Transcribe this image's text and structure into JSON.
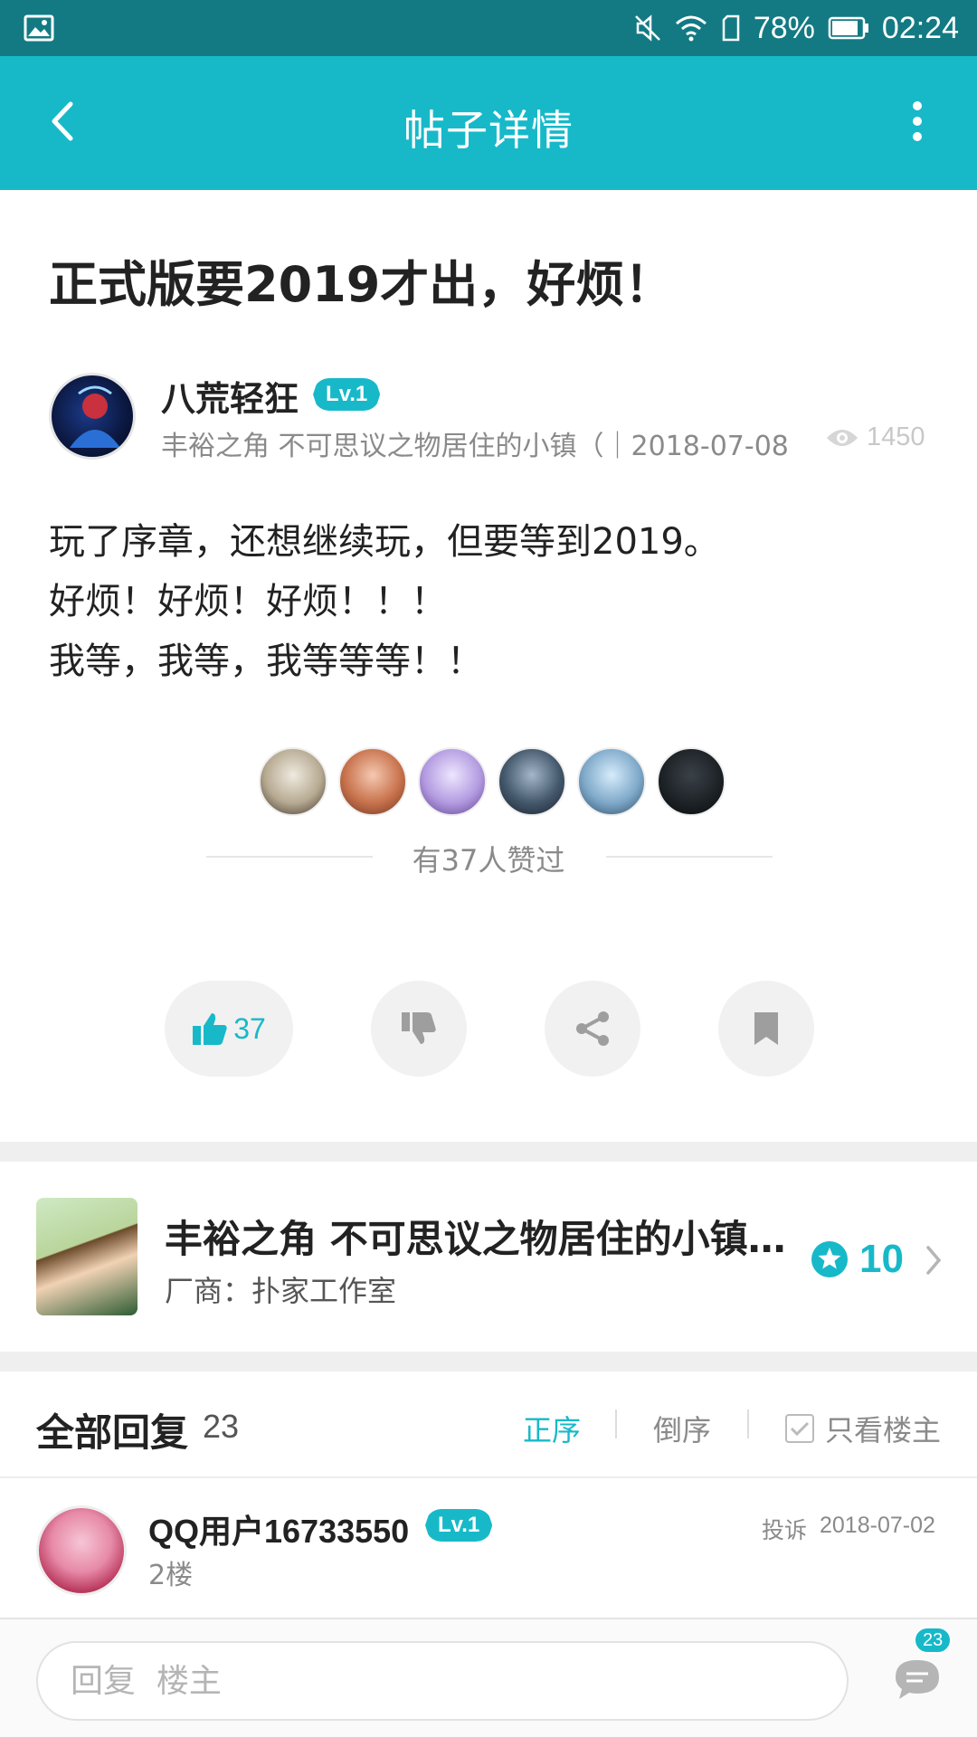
{
  "status_bar": {
    "battery": "78%",
    "time": "02:24"
  },
  "app_bar": {
    "title": "帖子详情"
  },
  "post": {
    "title": "正式版要2019才出，好烦！",
    "author": {
      "name": "八荒轻狂",
      "level": "Lv.1",
      "meta": "丰裕之角 不可思议之物居住的小镇（｜2018-07-08"
    },
    "views": "1450",
    "body_lines": [
      "玩了序章，还想继续玩，但要等到2019。",
      "好烦！好烦！好烦！！！",
      "我等，我等，我等等等！！"
    ],
    "likers": [
      {
        "name": "liker-1",
        "color": "#d9d4c9"
      },
      {
        "name": "liker-2",
        "color": "#c98a6a"
      },
      {
        "name": "liker-3",
        "color": "#b8a6dc"
      },
      {
        "name": "liker-4",
        "color": "#3c4f63"
      },
      {
        "name": "liker-5",
        "color": "#7fa9c9"
      },
      {
        "name": "liker-6",
        "color": "#1b2024"
      }
    ],
    "likers_text": "有37人赞过",
    "actions": {
      "like_count": "37"
    }
  },
  "game": {
    "title": "丰裕之角 不可思议之物居住的小镇（...",
    "developer": "厂商：扑家工作室",
    "score": "10"
  },
  "replies": {
    "title": "全部回复",
    "count": "23",
    "sort_asc": "正序",
    "sort_desc": "倒序",
    "only_op": "只看楼主",
    "items": [
      {
        "user": "QQ用户16733550",
        "level": "Lv.1",
        "floor": "2楼",
        "report": "投诉",
        "date": "2018-07-02"
      }
    ]
  },
  "bottom_bar": {
    "placeholder": "回复  楼主",
    "comment_badge": "23"
  },
  "colors": {
    "status_bar": "#137a83",
    "accent": "#17b9c9"
  }
}
